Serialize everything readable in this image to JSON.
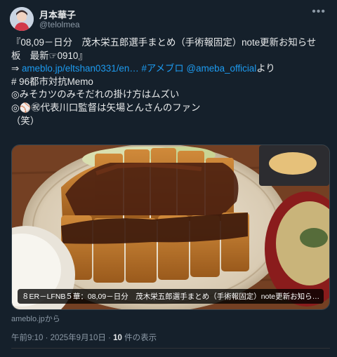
{
  "user": {
    "display_name": "月本華子",
    "handle": "@telolmea"
  },
  "more_icon": "more-horizontal-icon",
  "tweet": {
    "line1": "『08,09－日分　茂木栄五郎選手まとめ（手術報固定）note更新お知らせ",
    "line2": "板　最新☞0910』",
    "arrow": "⇒ ",
    "link_url": "ameblo.jp/eltshan0331/en…",
    "hashtag": "#アメブロ",
    "mention": "@ameba_official",
    "suffix": "より",
    "line4": "# 96都市対抗Memo",
    "line5": "◎みそカツのみそだれの掛け方はムズい",
    "line6": "◎⚾㊗代表川口監督は矢場とんさんのファン",
    "line7": "（笑）"
  },
  "card": {
    "caption": "８ER－LFNB５華：08,09－日分　茂木栄五郎選手まとめ（手術報固定）note更新お知ら…",
    "domain_label": "ameblo.jpから"
  },
  "meta": {
    "time": "午前9:10 · 2025年9月10日 · ",
    "views_count": "10",
    "views_label": " 件の表示"
  }
}
